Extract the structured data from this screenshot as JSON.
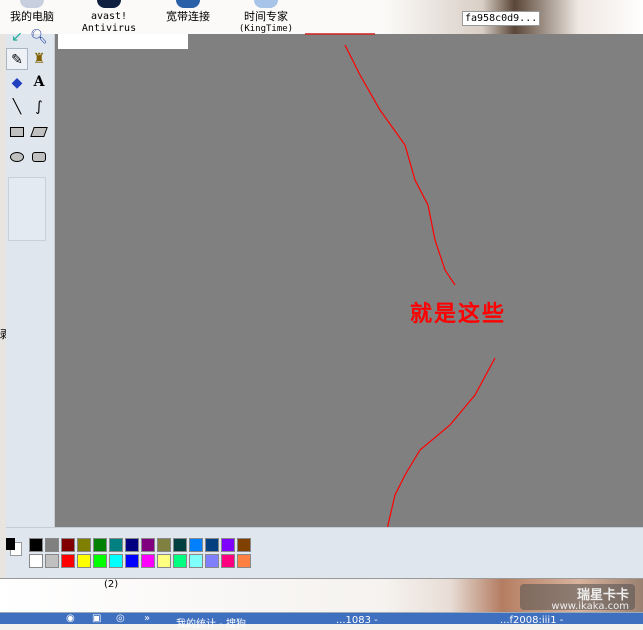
{
  "desktop": {
    "icons": [
      {
        "label": "我的电脑"
      },
      {
        "label": "avast!\nAntivirus",
        "line1": "avast!",
        "line2": "Antivirus"
      },
      {
        "label": "宽带连接"
      },
      {
        "label": "时间专家",
        "line2": "(KingTime)"
      }
    ],
    "file_label": "fa958c0d9..."
  },
  "toolbar": {
    "tools": [
      "select",
      "magnifier",
      "pencil",
      "brush",
      "airbrush",
      "text",
      "line",
      "curve",
      "rectangle",
      "polygon",
      "ellipse",
      "rounded-rectangle"
    ],
    "selected": "pencil",
    "text_tool_glyph": "A"
  },
  "canvas": {
    "background": "#808080",
    "annotation": "就是这些",
    "annotation_color": "#ff0000"
  },
  "palette": {
    "row1": [
      "#000000",
      "#808080",
      "#800000",
      "#808000",
      "#008000",
      "#008080",
      "#000080",
      "#800080",
      "#808040",
      "#004040",
      "#0080ff",
      "#004080",
      "#8000ff",
      "#804000"
    ],
    "row2": [
      "#ffffff",
      "#c0c0c0",
      "#ff0000",
      "#ffff00",
      "#00ff00",
      "#00ffff",
      "#0000ff",
      "#ff00ff",
      "#ffff80",
      "#00ff80",
      "#80ffff",
      "#8080ff",
      "#ff0080",
      "#ff8040"
    ],
    "primary": "#000000",
    "secondary": "#ffffff"
  },
  "bottom": {
    "stray_text": "(2)",
    "left_char": "绿",
    "watermark_cn": "瑞星卡卡",
    "watermark_url": "www.ikaka.com"
  },
  "taskbar": {
    "items": [
      "我的统计 - 搜狗",
      "...1083 -",
      "...f2008:iii1 -"
    ],
    "more": "»"
  }
}
